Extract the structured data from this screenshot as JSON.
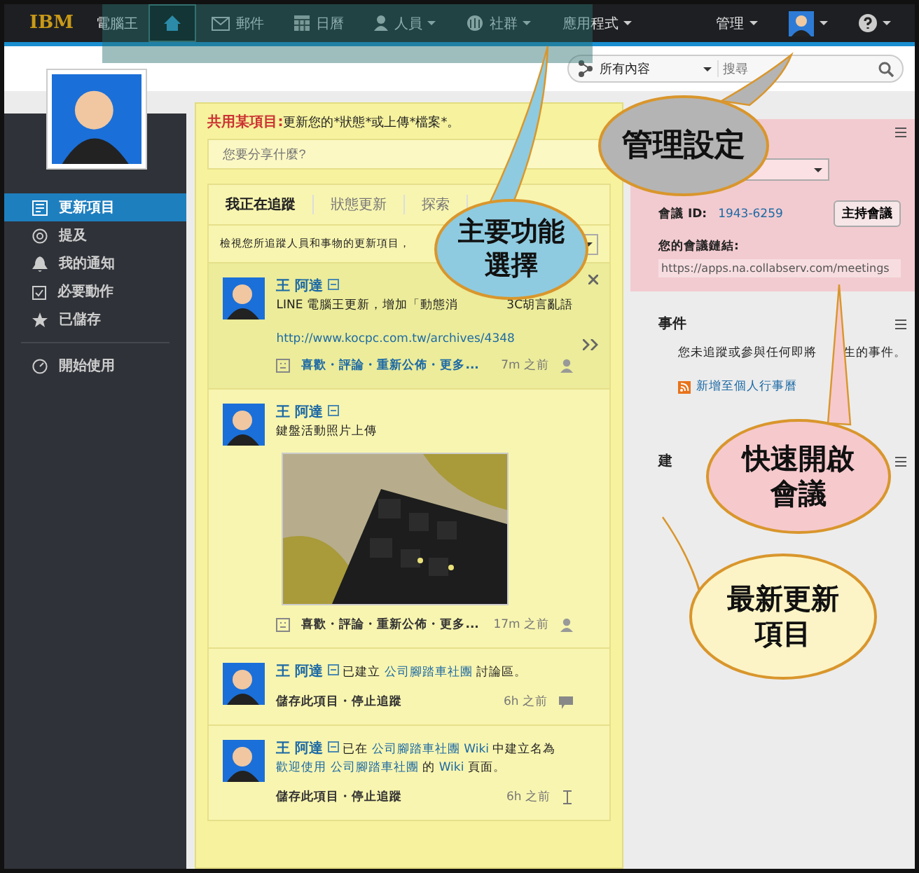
{
  "top_nav": {
    "brand": "IBM",
    "org": "電腦王",
    "items": [
      {
        "kind": "home",
        "selected": true,
        "dropdown": false
      },
      {
        "kind": "mail",
        "label": "郵件",
        "selected": false,
        "dropdown": false
      },
      {
        "kind": "calendar",
        "label": "日曆",
        "selected": false,
        "dropdown": false
      },
      {
        "kind": "person",
        "label": "人員",
        "selected": false,
        "dropdown": true
      },
      {
        "kind": "community",
        "label": "社群",
        "selected": false,
        "dropdown": true
      },
      {
        "kind": "apps",
        "label": "應用程式",
        "selected": false,
        "dropdown": true
      }
    ],
    "admin": "管理"
  },
  "search": {
    "scope": "所有內容",
    "placeholder": "搜尋"
  },
  "sidebar": {
    "items": [
      {
        "kind": "updates",
        "label": "更新項目",
        "selected": true
      },
      {
        "kind": "mention",
        "label": "提及",
        "selected": false
      },
      {
        "kind": "bell",
        "label": "我的通知",
        "selected": false
      },
      {
        "kind": "clipboard",
        "label": "必要動作",
        "selected": false
      },
      {
        "kind": "star",
        "label": "已儲存",
        "selected": false
      },
      {
        "kind": "start",
        "label": "開始使用",
        "selected": false
      }
    ]
  },
  "share": {
    "label": "共用某項目:",
    "text": "更新您的*狀態*或上傳*檔案*。",
    "placeholder": "您要分享什麼?"
  },
  "tabs": [
    {
      "label": "我正在追蹤",
      "selected": true
    },
    {
      "label": "狀態更新",
      "selected": false
    },
    {
      "label": "探索",
      "selected": false
    }
  ],
  "filter_text": "檢視您所追蹤人員和事物的更新項目，",
  "posts": [
    {
      "kind": "status",
      "author": "王 阿達",
      "highlighted": true,
      "segments": [
        {
          "text": "LINE 電腦王更新，增加「動態消",
          "link": false
        }
      ],
      "tail": "3C胡言亂語",
      "url": "http://www.kocpc.com.tw/archives/4348",
      "picture": false,
      "actions": "喜歡・評論・重新公佈・更多...",
      "time": "7m 之前"
    },
    {
      "kind": "status",
      "author": "王 阿達",
      "highlighted": false,
      "segments": [
        {
          "text": "鍵盤活動照片上傳",
          "link": false
        }
      ],
      "picture": true,
      "actions": "喜歡・評論・重新公佈・更多...",
      "time": "17m 之前"
    },
    {
      "kind": "activity",
      "author": "王 阿達",
      "highlighted": false,
      "segments": [
        {
          "text": "已建立 ",
          "link": false
        },
        {
          "text": "公司腳踏車社團",
          "link": true
        },
        {
          "text": " 討論區。",
          "link": false
        }
      ],
      "picture": false,
      "actions": "儲存此項目・停止追蹤",
      "time": "6h 之前"
    },
    {
      "kind": "activity",
      "author": "王 阿達",
      "highlighted": false,
      "segments": [
        {
          "text": "已在 ",
          "link": false
        },
        {
          "text": "公司腳踏車社團",
          "link": true
        },
        {
          "text": " Wiki ",
          "link": true
        },
        {
          "text": "中建立名為 ",
          "link": false
        },
        {
          "text": "歡迎使用 公司腳踏車社團",
          "link": true
        },
        {
          "text": " 的 ",
          "link": false
        },
        {
          "text": "Wiki",
          "link": true
        },
        {
          "text": " 頁面。",
          "link": false
        }
      ],
      "picture": false,
      "actions": "儲存此項目・停止追蹤",
      "time": "6h 之前"
    }
  ],
  "meeting": {
    "id_label": "會議 ID:",
    "id": "1943-6259",
    "host_button": "主持會議",
    "link_label": "您的會議鏈結:",
    "link": "https://apps.na.collabserv.com/meetings"
  },
  "events": {
    "title": "事件",
    "text": "您未追蹤或參與任何即將",
    "text_2": "生的事件。",
    "link": "新增至個人行事曆"
  },
  "suggestions": {
    "title": "建"
  },
  "callouts": [
    {
      "text": "主要功能選擇",
      "color": "#8ecbe0"
    },
    {
      "text": "管理設定",
      "color": "#b4b4b4"
    },
    {
      "text": "快速開啟會議",
      "color": "#f6c9cd"
    },
    {
      "text": "最新更新項目",
      "color": "#fcf4c6"
    }
  ]
}
